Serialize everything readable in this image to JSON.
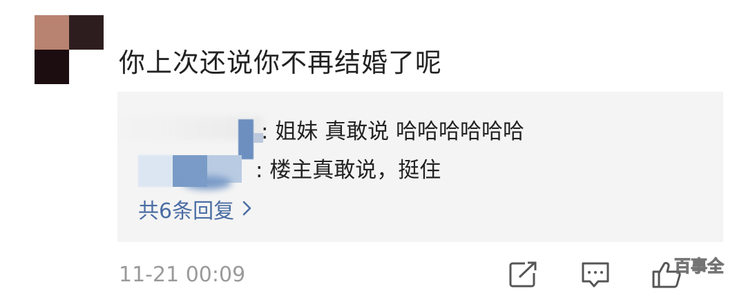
{
  "comment": {
    "text": "你上次还说你不再结婚了呢",
    "time": "11-21 00:09"
  },
  "replies": [
    {
      "text": ": 姐妹 真敢说 哈哈哈哈哈哈"
    },
    {
      "text": ": 楼主真敢说，挺住"
    }
  ],
  "more_replies": {
    "label": "共6条回复",
    "chevron": "›"
  },
  "actions": {
    "share_icon": "share-icon",
    "comment_icon": "comment-icon",
    "like_icon": "thumbs-up-icon"
  },
  "watermark": "百事全",
  "colors": {
    "link": "#4a6da3",
    "reply_bg": "#f4f4f4",
    "time": "#9a9a9a"
  }
}
